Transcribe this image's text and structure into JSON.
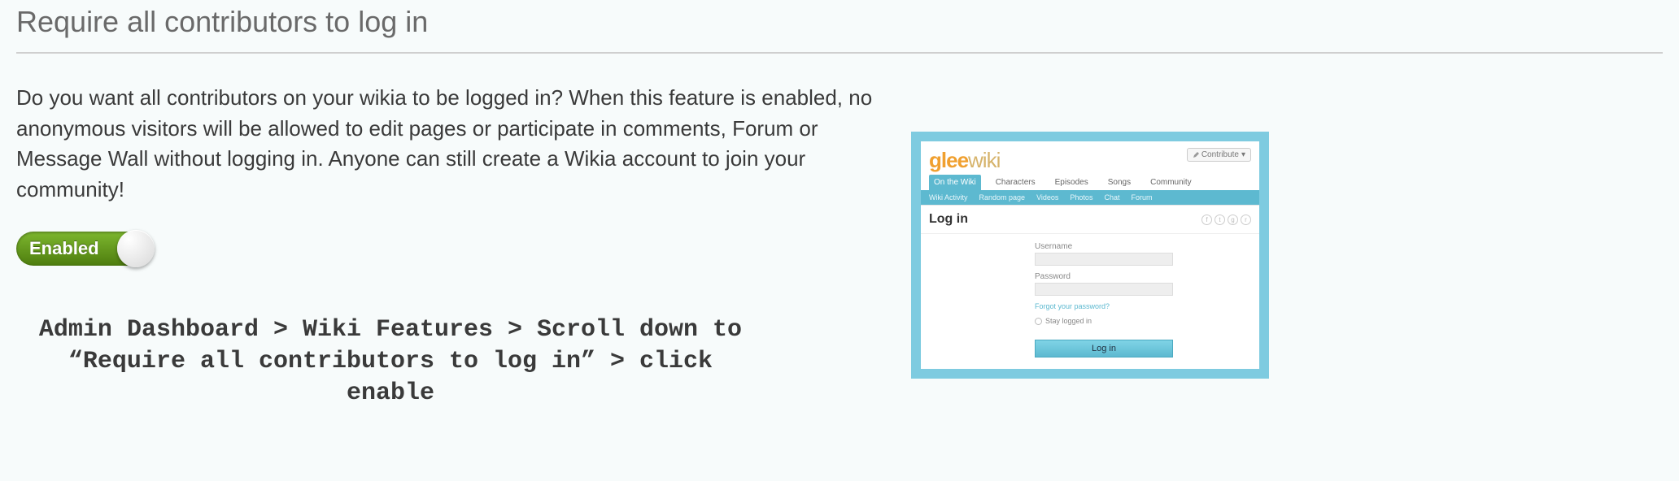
{
  "feature": {
    "title": "Require all contributors to log in",
    "description": "Do you want all contributors on your wikia to be logged in? When this feature is enabled, no anonymous visitors will be allowed to edit pages or participate in comments, Forum or Message Wall without logging in. Anyone can still create a Wikia account to join your community!",
    "toggle_label": "Enabled",
    "toggle_state": "on"
  },
  "instructions_text": "Admin Dashboard > Wiki Features > Scroll down to\n“Require all contributors to log in” > click enable",
  "preview": {
    "logo_primary": "glee",
    "logo_secondary": "wiki",
    "contribute_label": "Contribute",
    "tabs": [
      "On the Wiki",
      "Characters",
      "Episodes",
      "Songs",
      "Community"
    ],
    "subnav": [
      "Wiki Activity",
      "Random page",
      "Videos",
      "Photos",
      "Chat",
      "Forum"
    ],
    "page_title": "Log in",
    "username_label": "Username",
    "password_label": "Password",
    "forgot_label": "Forgot your password?",
    "stay_logged_label": "Stay logged in",
    "login_button": "Log in"
  }
}
